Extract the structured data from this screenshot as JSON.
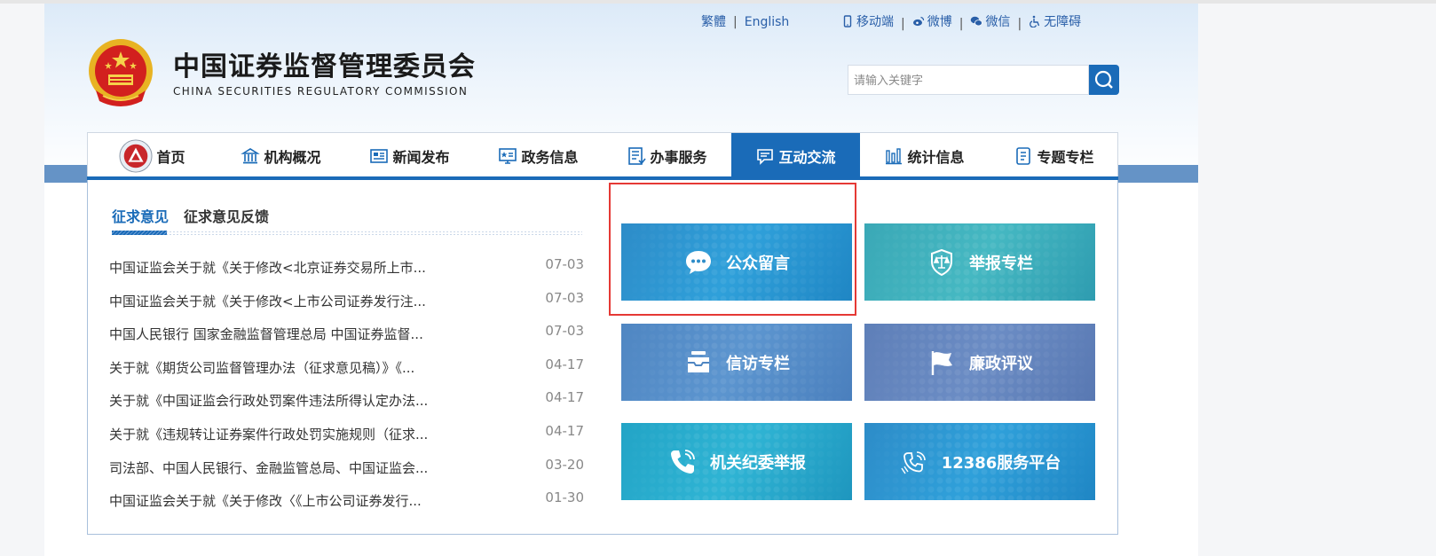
{
  "header": {
    "site_title": "中国证券监督管理委员会",
    "site_subtitle": "CHINA SECURITIES REGULATORY COMMISSION",
    "lang_links": [
      "繁體",
      "English"
    ],
    "util_links": [
      {
        "label": "移动端",
        "icon": "mobile-icon"
      },
      {
        "label": "微博",
        "icon": "weibo-icon"
      },
      {
        "label": "微信",
        "icon": "wechat-icon"
      },
      {
        "label": "无障碍",
        "icon": "accessibility-icon"
      }
    ],
    "search": {
      "placeholder": "请输入关键字",
      "value": ""
    }
  },
  "nav": {
    "items": [
      {
        "label": "首页",
        "icon": "csrc-emblem-icon"
      },
      {
        "label": "机构概况",
        "icon": "building-icon"
      },
      {
        "label": "新闻发布",
        "icon": "newspaper-icon"
      },
      {
        "label": "政务信息",
        "icon": "info-board-icon"
      },
      {
        "label": "办事服务",
        "icon": "document-list-icon"
      },
      {
        "label": "互动交流",
        "icon": "message-icon",
        "active": true
      },
      {
        "label": "统计信息",
        "icon": "bar-chart-icon"
      },
      {
        "label": "专题专栏",
        "icon": "notebook-icon"
      }
    ]
  },
  "tabs": [
    {
      "label": "征求意见",
      "active": true
    },
    {
      "label": "征求意见反馈",
      "active": false
    }
  ],
  "news": [
    {
      "title": "中国证监会关于就《关于修改<北京证券交易所上市...",
      "date": "07-03"
    },
    {
      "title": "中国证监会关于就《关于修改<上市公司证券发行注...",
      "date": "07-03"
    },
    {
      "title": "中国人民银行 国家金融监督管理总局 中国证券监督...",
      "date": "07-03"
    },
    {
      "title": "关于就《期货公司监督管理办法（征求意见稿）》《...",
      "date": "04-17"
    },
    {
      "title": "关于就《中国证监会行政处罚案件违法所得认定办法...",
      "date": "04-17"
    },
    {
      "title": "关于就《违规转让证券案件行政处罚实施规则（征求...",
      "date": "04-17"
    },
    {
      "title": "司法部、中国人民银行、金融监管总局、中国证监会...",
      "date": "03-20"
    },
    {
      "title": "中国证监会关于就《关于修改〈《上市公司证券发行...",
      "date": "01-30"
    }
  ],
  "tiles": [
    {
      "label": "公众留言",
      "icon": "chat-bubble-icon",
      "color": "#2d8cc8"
    },
    {
      "label": "举报专栏",
      "icon": "shield-scale-icon",
      "color": "#3aa8b6"
    },
    {
      "label": "信访专栏",
      "icon": "inbox-icon",
      "color": "#4f86c2"
    },
    {
      "label": "廉政评议",
      "icon": "flag-icon",
      "color": "#5e7fb8"
    },
    {
      "label": "机关纪委举报",
      "icon": "phone-icon",
      "color": "#22a4c6"
    },
    {
      "label": "12386服务平台",
      "icon": "hotline-icon",
      "color": "#2d8cc8"
    }
  ],
  "colors": {
    "brand_blue": "#1a6bb8",
    "highlight_red": "#e53935",
    "band_blue": "#6593c6"
  }
}
